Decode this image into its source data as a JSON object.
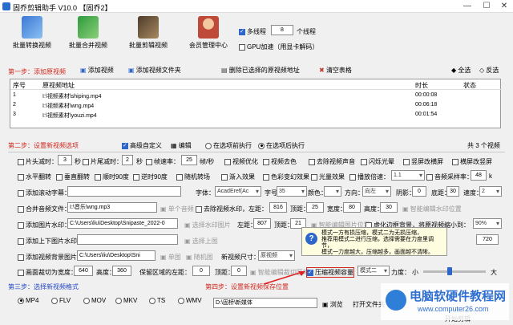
{
  "title": "固乔剪辑助手 V10.0 【固乔2】",
  "window_controls": {
    "min": "—",
    "max": "☐",
    "close": "✕"
  },
  "toolbar": {
    "batch_convert": "批量转换视频",
    "batch_merge": "批量合并视频",
    "batch_cut": "批量剪辑视频",
    "member": "会员管理中心",
    "multithread": "多线程",
    "threads_value": "8",
    "threads_unit": "个线程",
    "gpu": "GPU加速（用显卡解码）"
  },
  "step1": {
    "title": "第一步：添加原视频",
    "add_video": "添加视频",
    "add_folder": "添加视频文件夹",
    "delete_selected": "删除已选择的原视频地址",
    "clear_table": "清空表格",
    "select_all": "全选",
    "invert": "反选"
  },
  "table": {
    "headers": [
      "序号",
      "原视频地址",
      "时长",
      "状态"
    ],
    "rows": [
      {
        "index": "1",
        "path": "I:\\视频素材\\shiping.mp4",
        "duration": "00:00:08"
      },
      {
        "index": "2",
        "path": "I:\\视频素材\\wng.mp4",
        "duration": "00:06:18"
      },
      {
        "index": "3",
        "path": "I:\\视频素材\\youzi.mp4",
        "duration": "00:01:54"
      }
    ]
  },
  "step2": {
    "title": "第二步：设置新视频选项",
    "advanced": "高级自定义",
    "edit": "编辑",
    "before": "在选项前执行",
    "after": "在选项后执行",
    "count": "共 3 个视频"
  },
  "row1": {
    "head_cut": "片头减时：",
    "head_val": "3",
    "sec1": "秒",
    "tail_cut": "片尾减时：",
    "tail_val": "2",
    "sec2": "秒",
    "fps": "帧速率：",
    "fps_val": "25",
    "fps_unit": "帧/秒",
    "optimize": "视频优化",
    "decolor": "视频去色",
    "remove_audio": "去除视频声音",
    "flash": "闪烁光晕",
    "vertical_blur": "竖屏改横屏",
    "horizontal_blur": "横屏改竖屏"
  },
  "row2": {
    "hflip": "水平翻转",
    "vflip": "垂直翻转",
    "cw90": "顺时90度",
    "ccw90": "逆时90度",
    "random_rotate": "随机转场",
    "fade": "渐入效果",
    "color_diff": "色彩变幻效果",
    "light": "光量效果",
    "speed": "播放倍速：",
    "speed_val": "1.1",
    "audio_sample": "音频采样率：",
    "sample_val": "48",
    "sample_unit": "k"
  },
  "row3": {
    "scroll_sub": "添加滚动字幕：",
    "font": "字体：",
    "font_val": "AcadEref(Ac",
    "size": "字号：",
    "size_val": "35",
    "color": "颜色：",
    "direction": "方向：",
    "dir_val": "向左",
    "shadow": "阴影：",
    "shadow_val": "0",
    "bottom": "底距：",
    "bottom_val": "30",
    "speed": "速度：",
    "speed_val": "2"
  },
  "row4": {
    "merge_audio": "合并音频文件：",
    "merge_path": "I:\\音乐\\wng.mp3",
    "single_audio": "单个音频",
    "remove_wm": "去除视频水印，左距：",
    "left": "816",
    "top_lbl": "顶距：",
    "top": "25",
    "width_lbl": "宽度：",
    "width": "80",
    "height_lbl": "高度：",
    "height": "30",
    "smart_wm": "智能编辑水印位置"
  },
  "row5": {
    "add_image_wm": "添加图片水印：",
    "img_path": "C:\\Users\\liu\\Desktop\\Snipaste_2022-0",
    "select_wm": "选择水印图片",
    "left_lbl": "左距：",
    "left": "807",
    "top_lbl": "顶距：",
    "top": "21",
    "smart_pos": "智能编辑图片位置",
    "virtual_border": "虚化边框背景，将原视频缩小到：",
    "pct": "90%"
  },
  "row6": {
    "add_header_img": "添加上下图片水印：",
    "select_top": "选择上图"
  },
  "row7": {
    "add_bg_img": "添加视频背景图片：",
    "bg_path": "C:\\Users\\liu\\Desktop\\Sni",
    "single": "单图",
    "random": "随机图",
    "new_size": "新视频尺寸：",
    "size_val": "原视频",
    "hw": "720"
  },
  "row8": {
    "crop_width": "画面裁切为宽度：",
    "w": "640",
    "h_lbl": "高度：",
    "h": "360",
    "keep_left": "保留区域的左距：",
    "kl": "0",
    "top_lbl": "顶距：",
    "kt": "0",
    "smart_crop": "智能编辑裁切区域",
    "compress": "压缩视频容量",
    "mode": "模式二",
    "strength": "力度：",
    "small": "小",
    "big": "大"
  },
  "tooltip": {
    "line1": "模式一方有损压缩，模式二为无损压缩，",
    "line2": "推荐用模式二进行压缩，选择需要在力度里调节，",
    "line3": "模式一力度越大，压缩越多，画面越不清晰。"
  },
  "step3": {
    "title": "第三步：选择新视频格式",
    "formats": [
      "MP4",
      "FLV",
      "MOV",
      "MKV",
      "TS",
      "WMV"
    ]
  },
  "step4": {
    "title": "第四步：设置新视频保存位置",
    "path": "D:\\固桥\\新媒体",
    "browse": "浏览",
    "open_folder": "打开文件夹",
    "start": "开始剪辑"
  },
  "watermark": {
    "name": "电脑软硬件教程网",
    "url": "www.computer26.com"
  }
}
